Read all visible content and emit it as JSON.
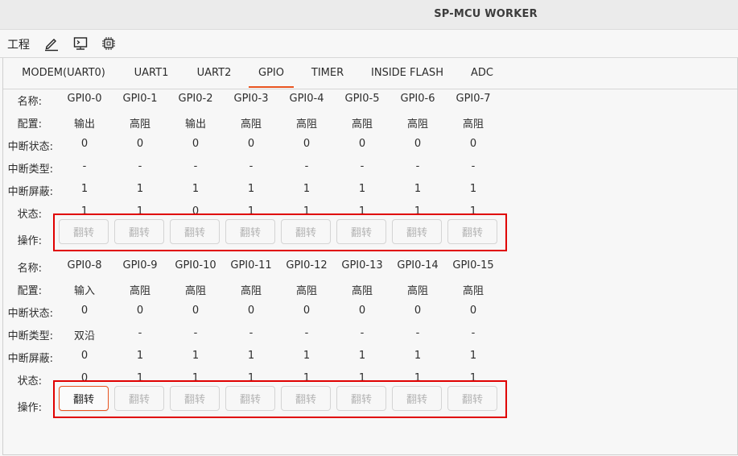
{
  "window": {
    "title": "SP-MCU WORKER"
  },
  "toolbar": {
    "menu_label": "工程",
    "icons": [
      "pencil-icon",
      "terminal-icon",
      "chip-icon"
    ]
  },
  "tabs": [
    {
      "label": "MODEM(UART0)"
    },
    {
      "label": "UART1"
    },
    {
      "label": "UART2"
    },
    {
      "label": "GPIO",
      "active": true
    },
    {
      "label": "TIMER"
    },
    {
      "label": "INSIDE FLASH"
    },
    {
      "label": "ADC"
    }
  ],
  "labels": {
    "name": "名称:",
    "config": "配置:",
    "irq_status": "中断状态:",
    "irq_type": "中断类型:",
    "irq_mask": "中断屏蔽:",
    "state": "状态:",
    "action": "操作:"
  },
  "groups": [
    {
      "pins": [
        {
          "name": "GPI0-0",
          "config": "输出",
          "irq_status": "0",
          "irq_type": "-",
          "irq_mask": "1",
          "state": "1",
          "button": "翻转",
          "enabled": false
        },
        {
          "name": "GPI0-1",
          "config": "高阻",
          "irq_status": "0",
          "irq_type": "-",
          "irq_mask": "1",
          "state": "1",
          "button": "翻转",
          "enabled": false
        },
        {
          "name": "GPI0-2",
          "config": "输出",
          "irq_status": "0",
          "irq_type": "-",
          "irq_mask": "1",
          "state": "0",
          "button": "翻转",
          "enabled": false
        },
        {
          "name": "GPI0-3",
          "config": "高阻",
          "irq_status": "0",
          "irq_type": "-",
          "irq_mask": "1",
          "state": "1",
          "button": "翻转",
          "enabled": false
        },
        {
          "name": "GPI0-4",
          "config": "高阻",
          "irq_status": "0",
          "irq_type": "-",
          "irq_mask": "1",
          "state": "1",
          "button": "翻转",
          "enabled": false
        },
        {
          "name": "GPI0-5",
          "config": "高阻",
          "irq_status": "0",
          "irq_type": "-",
          "irq_mask": "1",
          "state": "1",
          "button": "翻转",
          "enabled": false
        },
        {
          "name": "GPI0-6",
          "config": "高阻",
          "irq_status": "0",
          "irq_type": "-",
          "irq_mask": "1",
          "state": "1",
          "button": "翻转",
          "enabled": false
        },
        {
          "name": "GPI0-7",
          "config": "高阻",
          "irq_status": "0",
          "irq_type": "-",
          "irq_mask": "1",
          "state": "1",
          "button": "翻转",
          "enabled": false
        }
      ]
    },
    {
      "pins": [
        {
          "name": "GPI0-8",
          "config": "输入",
          "irq_status": "0",
          "irq_type": "双沿",
          "irq_mask": "0",
          "state": "0",
          "button": "翻转",
          "enabled": true
        },
        {
          "name": "GPI0-9",
          "config": "高阻",
          "irq_status": "0",
          "irq_type": "-",
          "irq_mask": "1",
          "state": "1",
          "button": "翻转",
          "enabled": false
        },
        {
          "name": "GPI0-10",
          "config": "高阻",
          "irq_status": "0",
          "irq_type": "-",
          "irq_mask": "1",
          "state": "1",
          "button": "翻转",
          "enabled": false
        },
        {
          "name": "GPI0-11",
          "config": "高阻",
          "irq_status": "0",
          "irq_type": "-",
          "irq_mask": "1",
          "state": "1",
          "button": "翻转",
          "enabled": false
        },
        {
          "name": "GPI0-12",
          "config": "高阻",
          "irq_status": "0",
          "irq_type": "-",
          "irq_mask": "1",
          "state": "1",
          "button": "翻转",
          "enabled": false
        },
        {
          "name": "GPI0-13",
          "config": "高阻",
          "irq_status": "0",
          "irq_type": "-",
          "irq_mask": "1",
          "state": "1",
          "button": "翻转",
          "enabled": false
        },
        {
          "name": "GPI0-14",
          "config": "高阻",
          "irq_status": "0",
          "irq_type": "-",
          "irq_mask": "1",
          "state": "1",
          "button": "翻转",
          "enabled": false
        },
        {
          "name": "GPI0-15",
          "config": "高阻",
          "irq_status": "0",
          "irq_type": "-",
          "irq_mask": "1",
          "state": "1",
          "button": "翻转",
          "enabled": false
        }
      ]
    }
  ],
  "colors": {
    "accent": "#e95420",
    "highlight_box": "#e00000"
  }
}
